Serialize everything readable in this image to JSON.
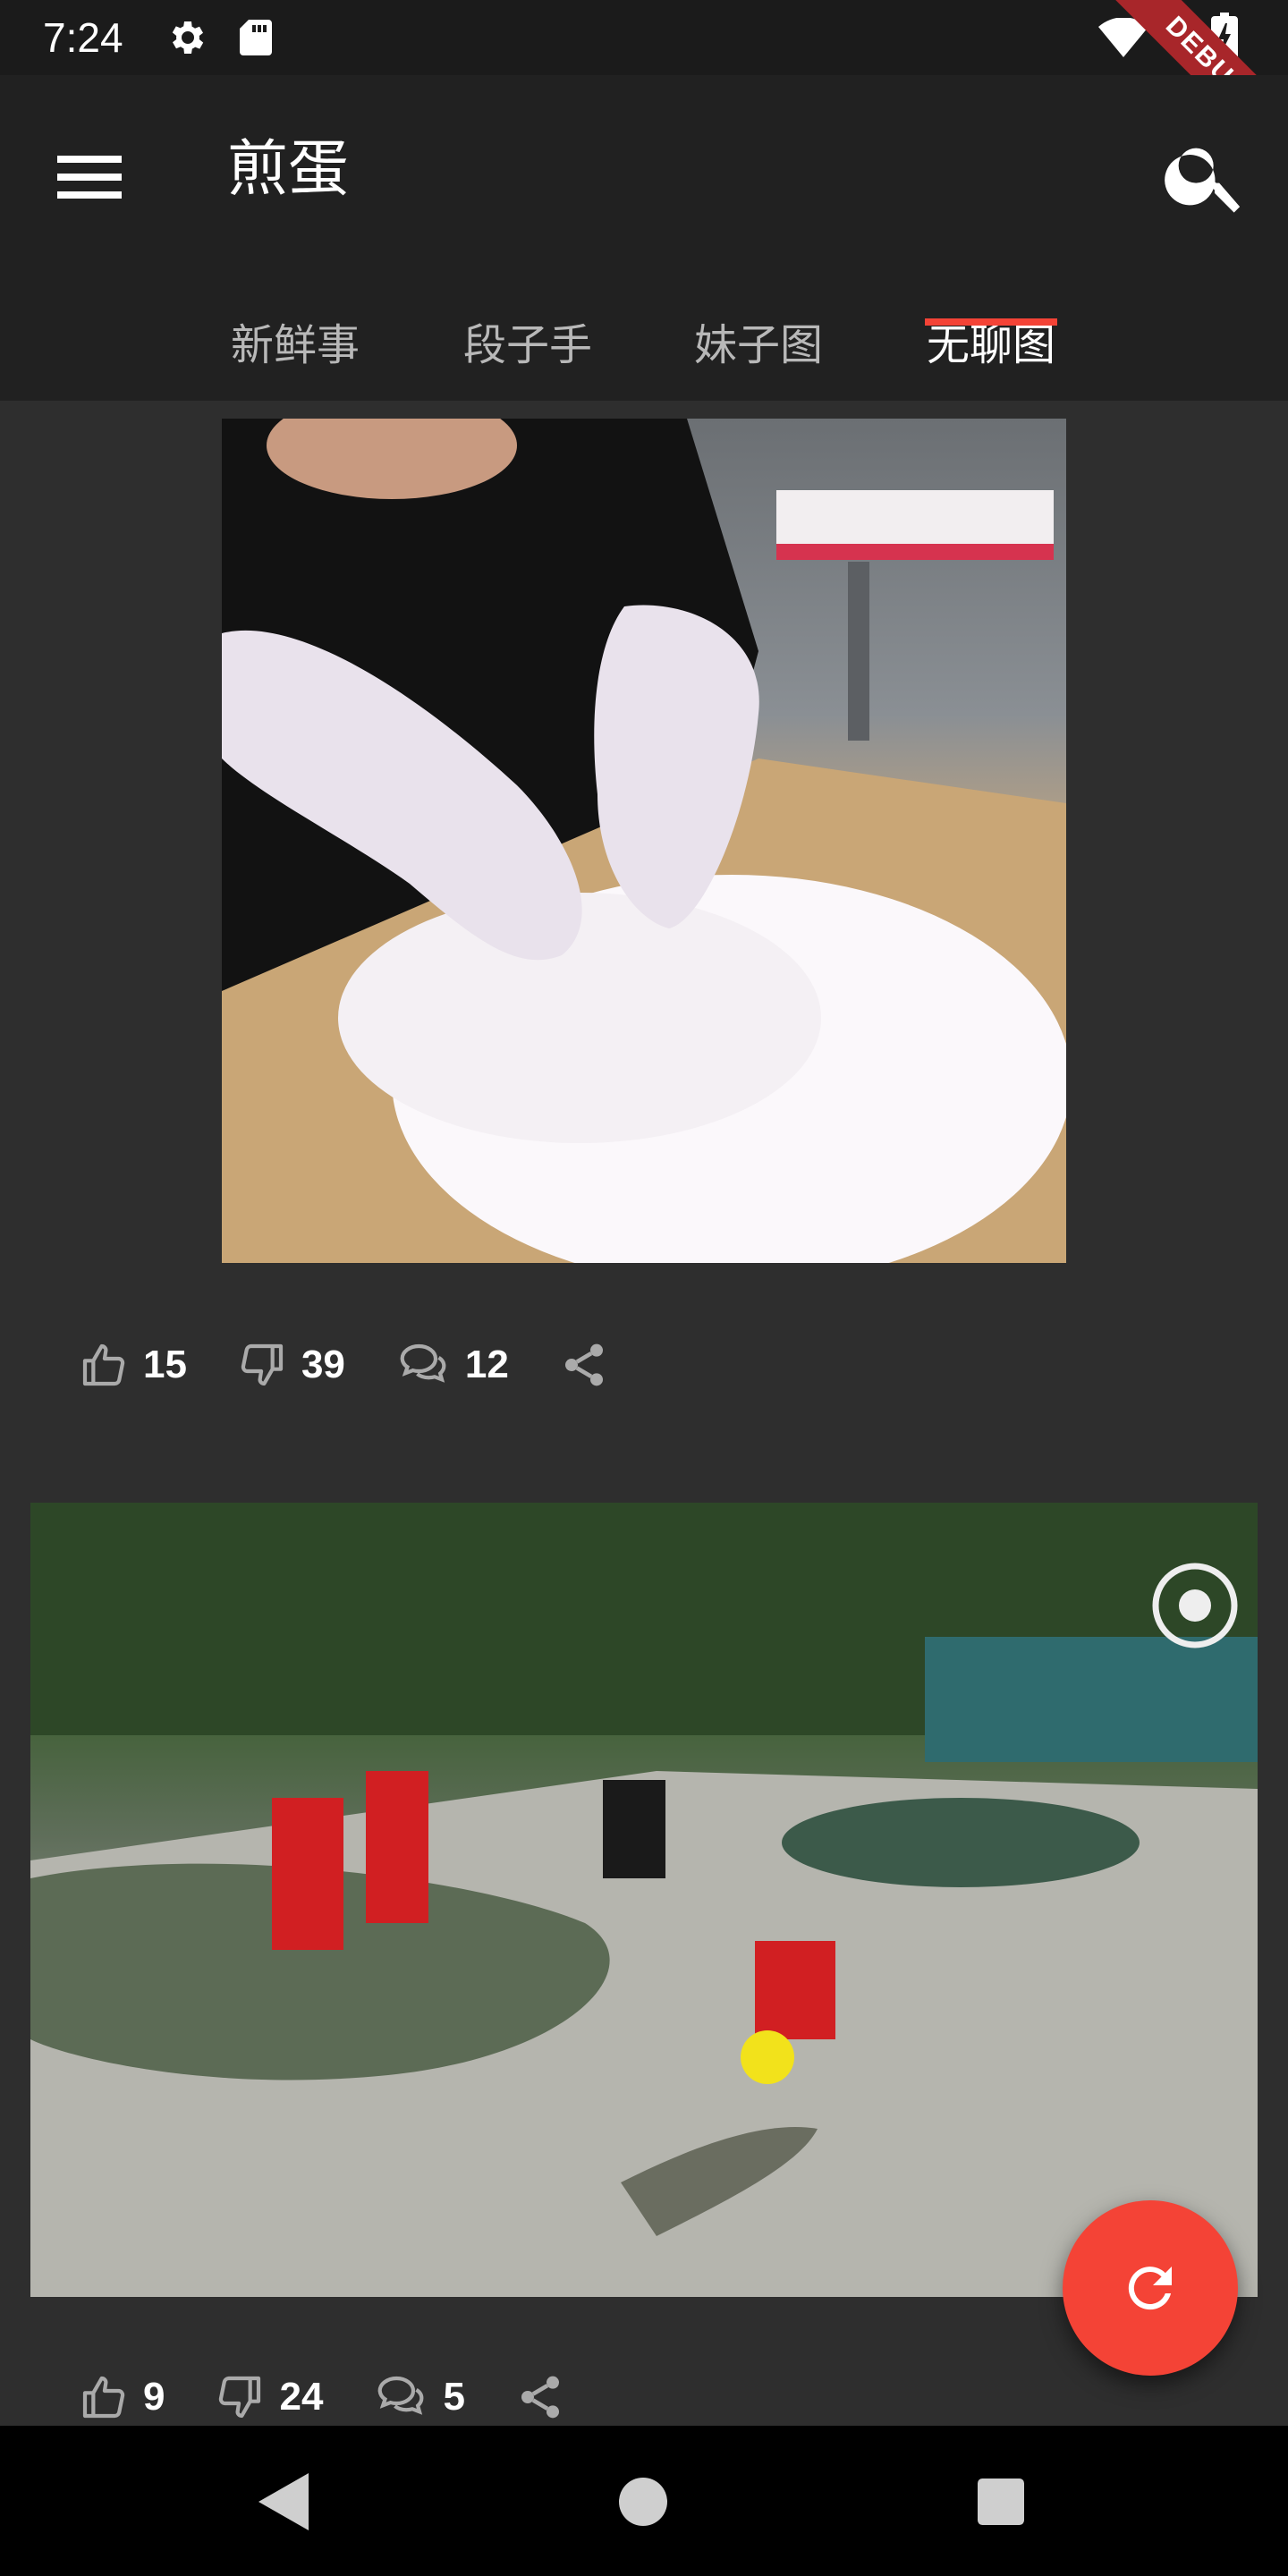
{
  "status_bar": {
    "time": "7:24",
    "icons": [
      "settings-icon",
      "sd-card-icon",
      "wifi-icon",
      "battery-icon"
    ],
    "debug_label": "DEBUG"
  },
  "app_bar": {
    "title": "煎蛋",
    "menu_icon": "menu-icon",
    "search_icon": "search-icon"
  },
  "tabs": [
    {
      "label": "新鲜事",
      "active": false
    },
    {
      "label": "段子手",
      "active": false
    },
    {
      "label": "妹子图",
      "active": false
    },
    {
      "label": "无聊图",
      "active": true
    }
  ],
  "posts": [
    {
      "image": "gif-hands-folding-plate",
      "likes": "15",
      "dislikes": "39",
      "comments": "12"
    },
    {
      "image": "gif-crocodile-show",
      "likes": "9",
      "dislikes": "24",
      "comments": "5"
    }
  ],
  "fab": {
    "icon": "refresh-icon"
  },
  "nav_bar": {
    "icons": [
      "back-icon",
      "home-icon",
      "recents-icon"
    ]
  },
  "colors": {
    "accent": "#f44336",
    "app_bar": "#212121",
    "background": "#2e2e2e",
    "status_bar": "#1b1b1b"
  }
}
